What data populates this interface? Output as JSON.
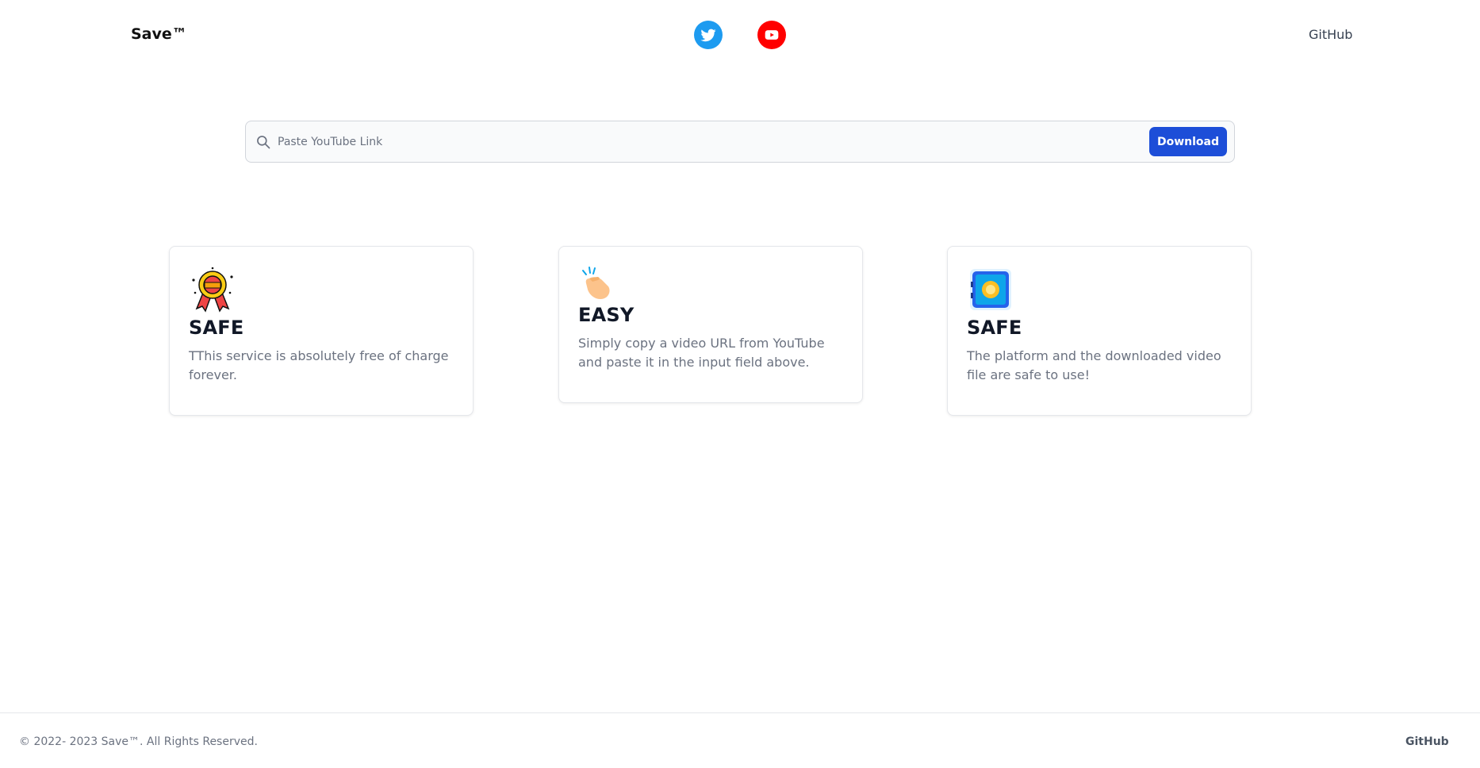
{
  "header": {
    "brand": "Save™",
    "github_label": "GitHub",
    "social": [
      {
        "icon": "twitter-icon",
        "color": "#1d9bf0"
      },
      {
        "icon": "youtube-icon",
        "color": "#ff0000"
      }
    ]
  },
  "search": {
    "placeholder": "Paste YouTube Link",
    "value": "",
    "button_label": "Download"
  },
  "cards": [
    {
      "icon": "free-badge-icon",
      "title": "SAFE",
      "text": "TThis service is absolutely free of charge forever."
    },
    {
      "icon": "snap-fingers-icon",
      "title": "EASY",
      "text": "Simply copy a video URL from YouTube and paste it in the input field above."
    },
    {
      "icon": "safe-vault-icon",
      "title": "SAFE",
      "text": "The platform and the downloaded video file are safe to use!"
    }
  ],
  "footer": {
    "copyright": "© 2022- 2023 Save™. All Rights Reserved.",
    "github_label": "GitHub"
  },
  "colors": {
    "accent": "#1d4ed8",
    "twitter": "#1d9bf0",
    "youtube": "#ff0000"
  }
}
